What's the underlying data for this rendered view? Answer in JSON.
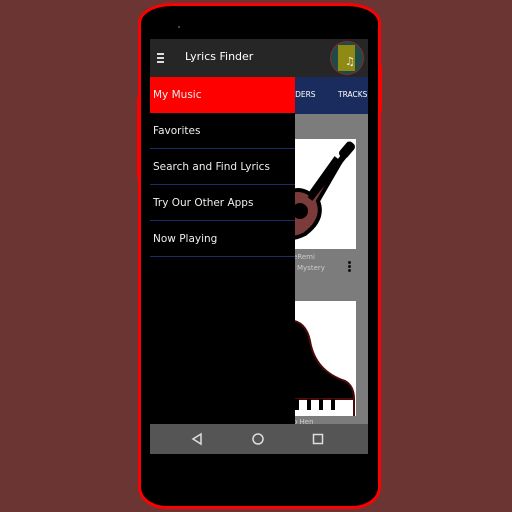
{
  "app": {
    "title": "Lyrics Finder"
  },
  "tabs": [
    {
      "label": "OLDERS"
    },
    {
      "label": "TRACKS"
    }
  ],
  "drawer": {
    "items": [
      {
        "label": "My Music",
        "active": true
      },
      {
        "label": "Favorites",
        "active": false
      },
      {
        "label": "Search and Find Lyrics",
        "active": false
      },
      {
        "label": "Try Our Other Apps",
        "active": false
      },
      {
        "label": "Now Playing",
        "active": false
      }
    ]
  },
  "content": {
    "cards": [
      {
        "title": "eRemi",
        "subtitle": "Mystery",
        "icon": "guitar-icon"
      },
      {
        "title": "o Hen",
        "subtitle": "",
        "icon": "piano-icon"
      }
    ]
  },
  "navbar": {
    "back": "back-icon",
    "home": "home-icon",
    "recent": "recent-apps-icon"
  },
  "colors": {
    "background": "#6b3534",
    "phone_frame": "#ff0000",
    "drawer_active": "#ff0000",
    "tabs_bg": "#1a2c5e",
    "toolbar_bg": "#262626"
  }
}
